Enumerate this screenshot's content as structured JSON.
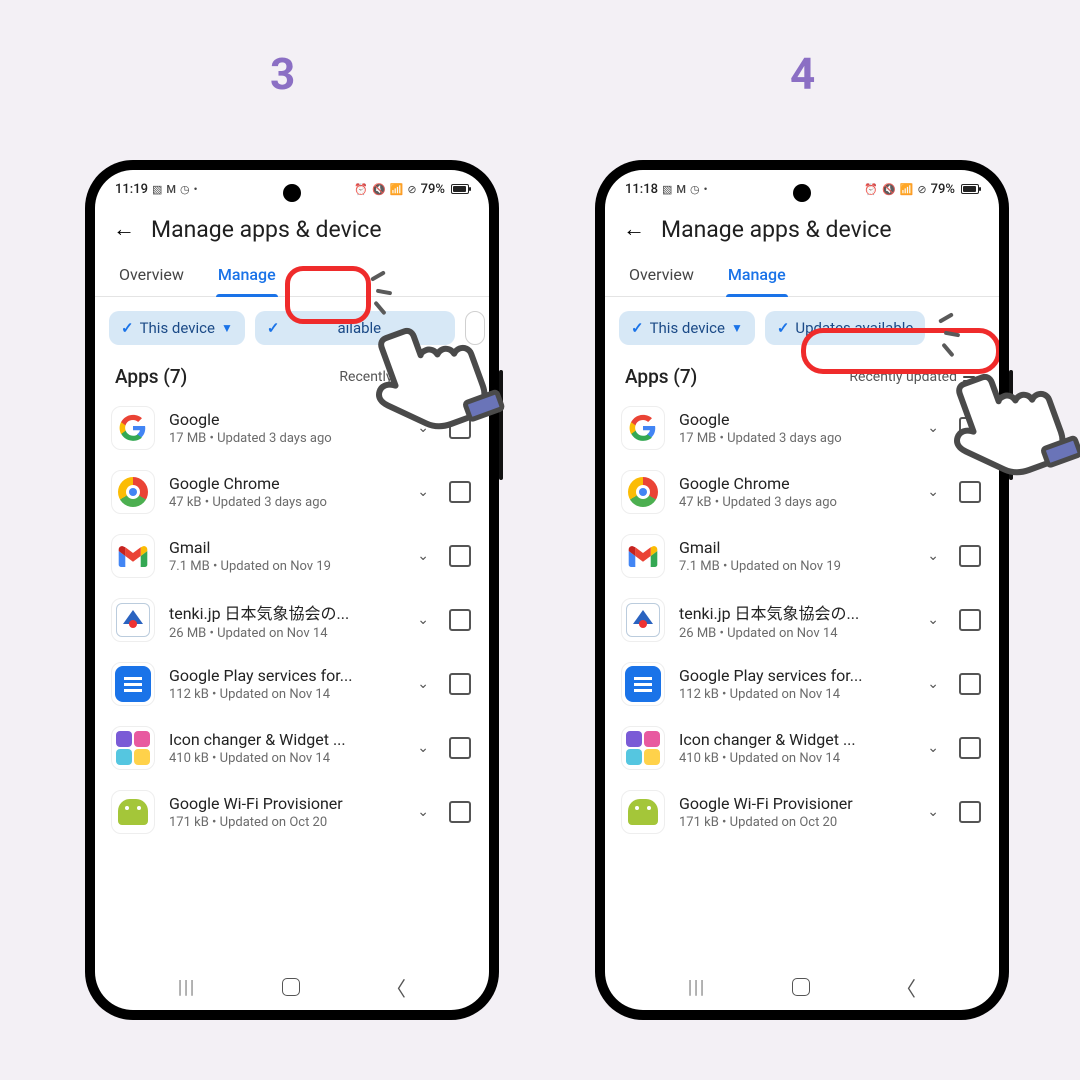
{
  "steps": {
    "left": "3",
    "right": "4"
  },
  "status": {
    "time_left": "11:19",
    "time_right": "11:18",
    "battery": "79%"
  },
  "header": {
    "title": "Manage apps & device"
  },
  "tabs": {
    "overview": "Overview",
    "manage": "Manage"
  },
  "chips": {
    "this_device": "This device",
    "updates_available": "Updates available"
  },
  "section": {
    "title": "Apps (7)",
    "sort": "Recently updated"
  },
  "apps": [
    {
      "name": "Google",
      "meta": "17 MB  •  Updated 3 days ago",
      "icon": "google"
    },
    {
      "name": "Google Chrome",
      "meta": "47 kB  •  Updated 3 days ago",
      "icon": "chrome"
    },
    {
      "name": "Gmail",
      "meta": "7.1 MB  •  Updated on Nov 19",
      "icon": "gmail"
    },
    {
      "name": "tenki.jp 日本気象協会の...",
      "meta": "26 MB  •  Updated on Nov 14",
      "icon": "tenki"
    },
    {
      "name": "Google Play services for...",
      "meta": "112 kB  •  Updated on Nov 14",
      "icon": "play"
    },
    {
      "name": "Icon changer & Widget ...",
      "meta": "410 kB  •  Updated on Nov 14",
      "icon": "iconch"
    },
    {
      "name": "Google Wi-Fi Provisioner",
      "meta": "171 kB  •  Updated on Oct 20",
      "icon": "droid"
    }
  ]
}
